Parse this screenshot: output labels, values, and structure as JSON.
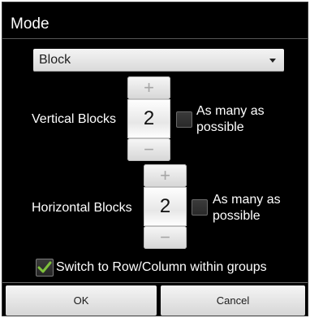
{
  "dialog": {
    "title": "Mode"
  },
  "mode_select": {
    "selected": "Block"
  },
  "vertical": {
    "label": "Vertical Blocks",
    "value": "2",
    "increment_glyph": "+",
    "decrement_glyph": "−",
    "many_label_line1": "As many as",
    "many_label_line2": "possible",
    "many_checked": false
  },
  "horizontal": {
    "label": "Horizontal Blocks",
    "value": "2",
    "increment_glyph": "+",
    "decrement_glyph": "−",
    "many_label_line1": "As many as",
    "many_label_line2": "possible",
    "many_checked": false
  },
  "switch_option": {
    "label": "Switch to Row/Column within groups",
    "checked": true,
    "check_color": "#7ec03c"
  },
  "buttons": {
    "ok": "OK",
    "cancel": "Cancel"
  },
  "icons": {
    "dropdown": "chevron-down-icon",
    "check": "checkmark-icon"
  }
}
